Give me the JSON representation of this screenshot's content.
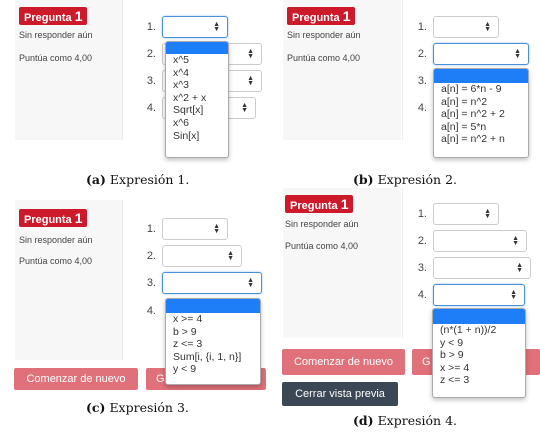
{
  "badge_label": "Pregunta",
  "badge_number": "1",
  "status": "Sin responder aún",
  "score": "Puntúa como 4,00",
  "arrow_icon": "up-down-caret-icon",
  "panels": {
    "a": {
      "caption_letter": "(a)",
      "caption_text": "Expresión 1.",
      "options": [
        "x^5",
        "x^4",
        "x^3",
        "x^2 + x",
        "Sqrt[x]",
        "x^6",
        "Sin[x]"
      ]
    },
    "b": {
      "caption_letter": "(b)",
      "caption_text": "Expresión 2.",
      "options": [
        "a[n] = 6*n - 9",
        "a[n] = n^2",
        "a[n] = n^2 + 2",
        "a[n] = 5*n",
        "a[n] = n^2 + n"
      ]
    },
    "c": {
      "caption_letter": "(c)",
      "caption_text": "Expresión 3.",
      "button_restart": "Comenzar de nuevo",
      "button_partial": "G",
      "options": [
        "x >= 4",
        "b > 9",
        "z <= 3",
        "Sum[i, {i, 1, n}]",
        "y < 9"
      ]
    },
    "d": {
      "caption_letter": "(d)",
      "caption_text": "Expresión 4.",
      "button_restart": "Comenzar de nuevo",
      "button_partial": "G",
      "button_close": "Cerrar vista previa",
      "options": [
        "(n*(1 + n))/2",
        "y < 9",
        "b > 9",
        "x >= 4",
        "z <= 3"
      ]
    }
  },
  "rows": [
    "1.",
    "2.",
    "3.",
    "4."
  ]
}
